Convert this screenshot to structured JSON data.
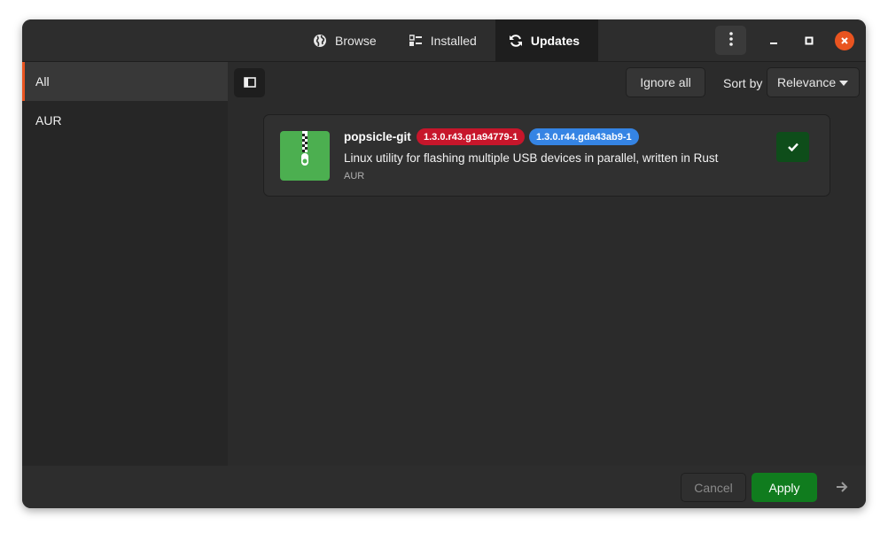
{
  "header": {
    "tabs": [
      {
        "label": "Browse",
        "icon": "globe-icon",
        "active": false
      },
      {
        "label": "Installed",
        "icon": "list-icon",
        "active": false
      },
      {
        "label": "Updates",
        "icon": "refresh-icon",
        "active": true
      }
    ],
    "menu_icon": "kebab-menu-icon",
    "window_controls": [
      "minimize-icon",
      "maximize-icon",
      "close-icon"
    ]
  },
  "sidebar": {
    "items": [
      {
        "label": "All",
        "active": true
      },
      {
        "label": "AUR",
        "active": false
      }
    ]
  },
  "toolbar": {
    "ignore_all_label": "Ignore all",
    "sort_by_label": "Sort by",
    "sort_value": "Relevance"
  },
  "packages": [
    {
      "name": "popsicle-git",
      "old_version": "1.3.0.r43.g1a94779-1",
      "new_version": "1.3.0.r44.gda43ab9-1",
      "description": "Linux utility for flashing multiple USB devices in parallel, written in Rust",
      "repo": "AUR",
      "selected": true
    }
  ],
  "footer": {
    "cancel_label": "Cancel",
    "apply_label": "Apply"
  },
  "colors": {
    "accent": "#e95420",
    "apply": "#107c1e",
    "old_version_badge": "#c7162b",
    "new_version_badge": "#3584e4",
    "package_icon": "#4caf50"
  }
}
